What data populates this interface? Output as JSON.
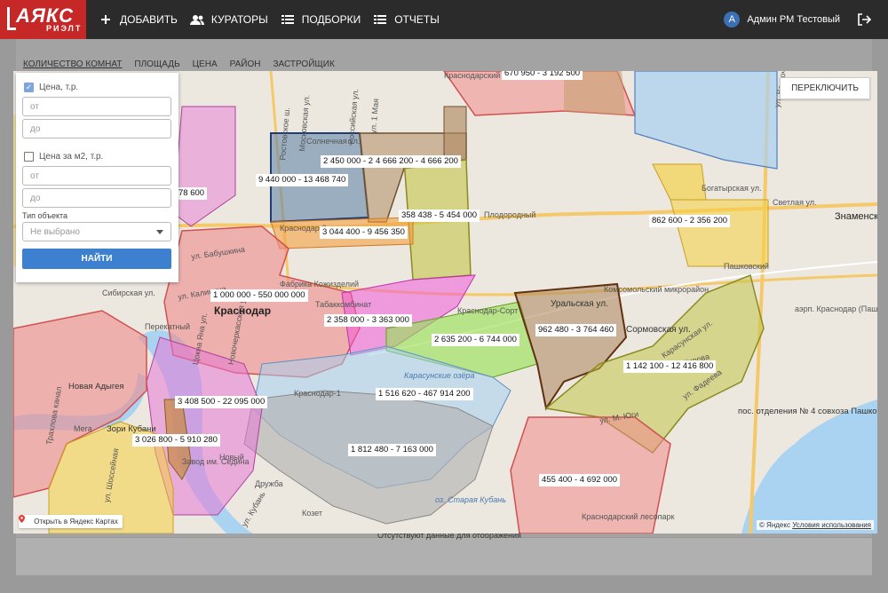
{
  "brand": {
    "logo_main": "АЯКС",
    "logo_sub": "РИЭЛТ"
  },
  "nav": {
    "items": [
      {
        "label": "ДОБАВИТЬ",
        "icon": "plus-icon"
      },
      {
        "label": "КУРАТОРЫ",
        "icon": "users-icon"
      },
      {
        "label": "ПОДБОРКИ",
        "icon": "list-icon"
      },
      {
        "label": "ОТЧЕТЫ",
        "icon": "list-icon"
      }
    ],
    "user_initial": "А",
    "user_name": "Админ РМ Тестовый"
  },
  "subtabs": [
    "КОЛИЧЕСТВО КОМНАТ",
    "ПЛОЩАДЬ",
    "ЦЕНА",
    "РАЙОН",
    "ЗАСТРОЙЩИК"
  ],
  "no_data_text": "Отсутствуют данные для отображения",
  "filter": {
    "price_label": "Цена, т.р.",
    "price_checked": true,
    "price_from_placeholder": "от",
    "price_to_placeholder": "до",
    "price_m2_label": "Цена за м2, т.р.",
    "price_m2_checked": false,
    "price_m2_from_placeholder": "от",
    "price_m2_to_placeholder": "до",
    "type_label": "Тип объекта",
    "type_value": "Не выбрано",
    "find_button": "НАЙТИ"
  },
  "map": {
    "switch_button": "ПЕРЕКЛЮЧИТЬ",
    "open_in_yandex": "Открыть в Яндекс Картах",
    "copyright": "© Яндекс",
    "terms": "Условия использования",
    "city_name": "Краснодар",
    "zone_colors": {
      "red": "#f08a8a",
      "pink": "#e879d6",
      "magenta": "#f05ad8",
      "green": "#9be05a",
      "olive": "#c4c44a",
      "brown": "#b08c64",
      "blue": "#a8d0f0",
      "gray": "#b4b4b4",
      "yellow": "#f5d040",
      "orange": "#f5a040",
      "navy": "#5a7ea6"
    },
    "price_labels": [
      "670 950 - 3 192 500",
      "2 450 000 - 2",
      "4 666 200 - 4 666 200",
      "9 440 000 - 13 468 740",
      "358 438 - 5 454 000",
      "78 600",
      "3 044 400 - 9 456 350",
      "862 600 - 2 356 200",
      "1 000 000 - 550 000 000",
      "2 358 000 - 3 363 000",
      "962 480 - 3 764 460",
      "2 635 200 - 6 744 000",
      "1 142 100 - 12 416 800",
      "3 408 500 - 22 095 000",
      "1 516 620 - 467 914 200",
      "3 026 800 - 5 910 280",
      "1 812 480 - 7 163 000",
      "455 400 - 4 692 000"
    ],
    "place_labels": [
      "Краснодарский",
      "Пашковский",
      "Плодородный",
      "Знаменск",
      "Новая Адыгея",
      "Зори Кубани",
      "Мега",
      "Перекатный",
      "Фабрика Кожизделий",
      "Табаккомбинат",
      "Краснодар-Сорт",
      "Краснодар-1",
      "Уральская ул.",
      "Сормовская ул.",
      "Карасунские озёра",
      "аэрп. Краснодар (Пашковский)",
      "пос. отделения № 4 совхоза Пашковский",
      "Краснодарский лесопарк",
      "оз. Старая Кубань",
      "Новый",
      "Дружба",
      "Козет",
      "Завод им. Седина",
      "Комсомольский микрорайон",
      "ул. Восточный Обход",
      "ул. Бабушкина",
      "ул. Калинина",
      "Светлая ул.",
      "Богатырская ул.",
      "Ростовское ш.",
      "Московская ул.",
      "Российская ул.",
      "ул. 1 Мая",
      "Солнечная ул.",
      "Краснодар-2",
      "ул. Кирова",
      "Карасунская ул.",
      "ул. Фадеева",
      "ул. Шоссейная",
      "ул. Кубань",
      "Трахлова канал",
      "ул. М. Юги",
      "Сибирская ул.",
      "Цокна Яна ул.",
      "Новочеркасская ул."
    ]
  }
}
